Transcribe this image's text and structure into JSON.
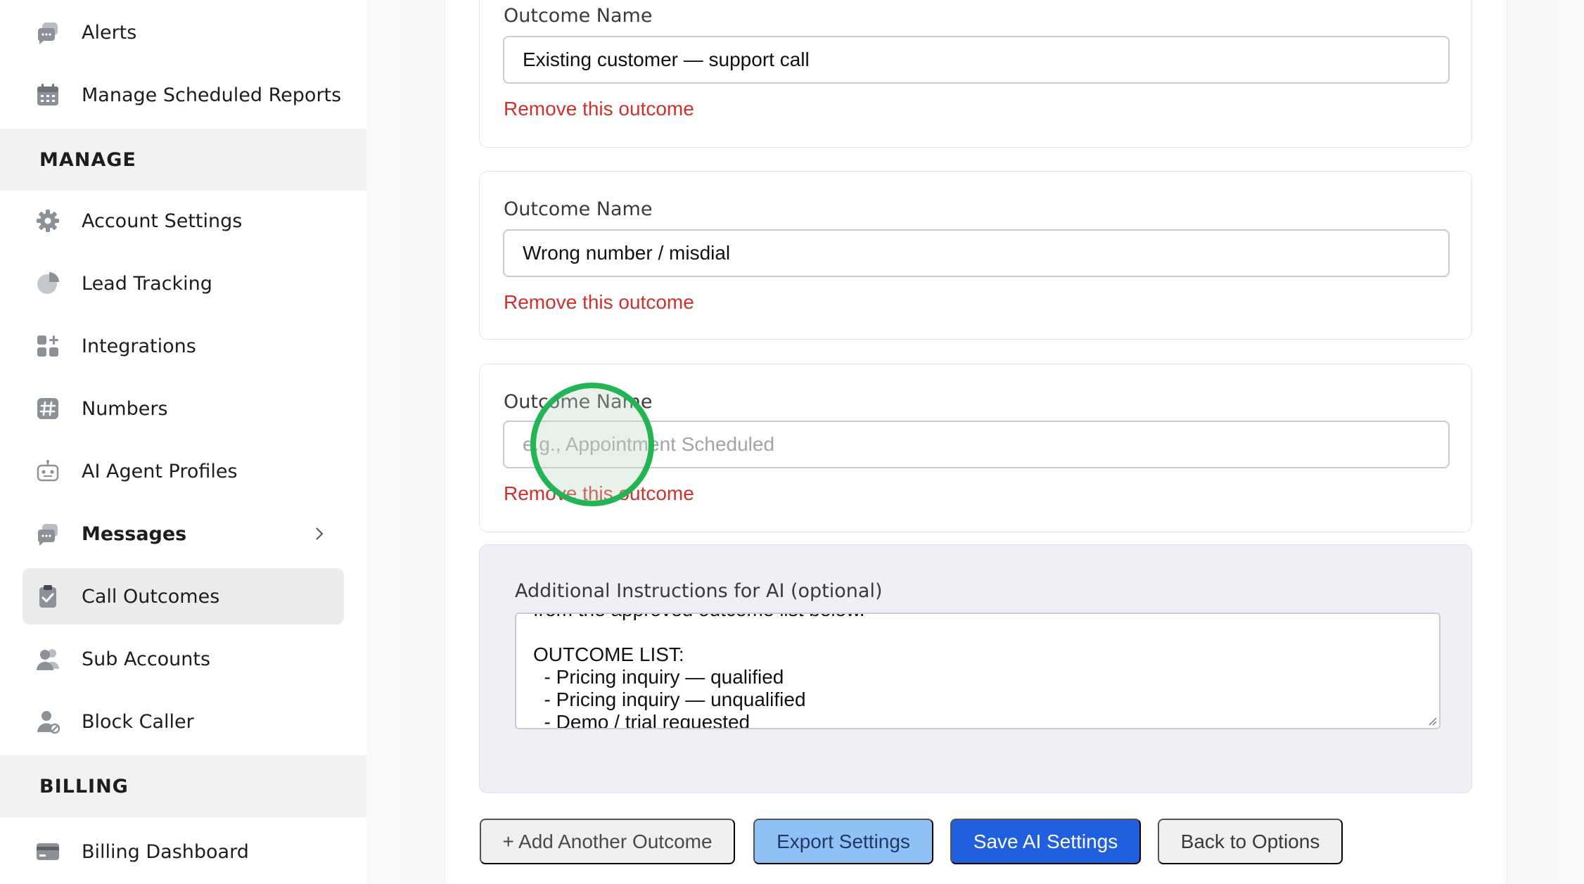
{
  "sidebar": {
    "items_top": [
      {
        "label": "Alerts",
        "icon": "chat-bubbles-icon"
      },
      {
        "label": "Manage Scheduled Reports",
        "icon": "calendar-icon"
      }
    ],
    "manage_heading": "MANAGE",
    "manage_items": [
      {
        "label": "Account Settings",
        "icon": "gear-icon"
      },
      {
        "label": "Lead Tracking",
        "icon": "pie-chart-icon"
      },
      {
        "label": "Integrations",
        "icon": "grid-plus-icon"
      },
      {
        "label": "Numbers",
        "icon": "hash-icon"
      },
      {
        "label": "AI Agent Profiles",
        "icon": "robot-icon"
      },
      {
        "label": "Messages",
        "icon": "chat-bubbles-icon"
      },
      {
        "label": "Call Outcomes",
        "icon": "clipboard-check-icon",
        "active": true
      },
      {
        "label": "Sub Accounts",
        "icon": "users-icon"
      },
      {
        "label": "Block Caller",
        "icon": "user-block-icon"
      }
    ],
    "billing_heading": "BILLING",
    "billing_items": [
      {
        "label": "Billing Dashboard",
        "icon": "credit-card-icon"
      }
    ]
  },
  "outcomes": [
    {
      "label": "Outcome Name",
      "value": "Existing customer — support call",
      "remove": "Remove this outcome"
    },
    {
      "label": "Outcome Name",
      "value": "Wrong number / misdial",
      "remove": "Remove this outcome"
    },
    {
      "label": "Outcome Name",
      "value": "",
      "placeholder": "e.g., Appointment Scheduled",
      "remove": "Remove this outcome"
    }
  ],
  "instructions": {
    "label": "Additional Instructions for AI (optional)",
    "visible_lines": [
      "from the approved outcome list below.",
      "",
      "OUTCOME LIST:",
      "  - Pricing inquiry — qualified",
      "  - Pricing inquiry — unqualified",
      "  - Demo / trial requested"
    ]
  },
  "buttons": {
    "add": "+ Add Another Outcome",
    "export": "Export Settings",
    "save": "Save AI Settings",
    "back": "Back to Options"
  },
  "colors": {
    "remove_link": "#d0312d",
    "save_button": "#1f5fe0",
    "export_button": "#8fc1f7",
    "click_indicator": "#22b455"
  }
}
